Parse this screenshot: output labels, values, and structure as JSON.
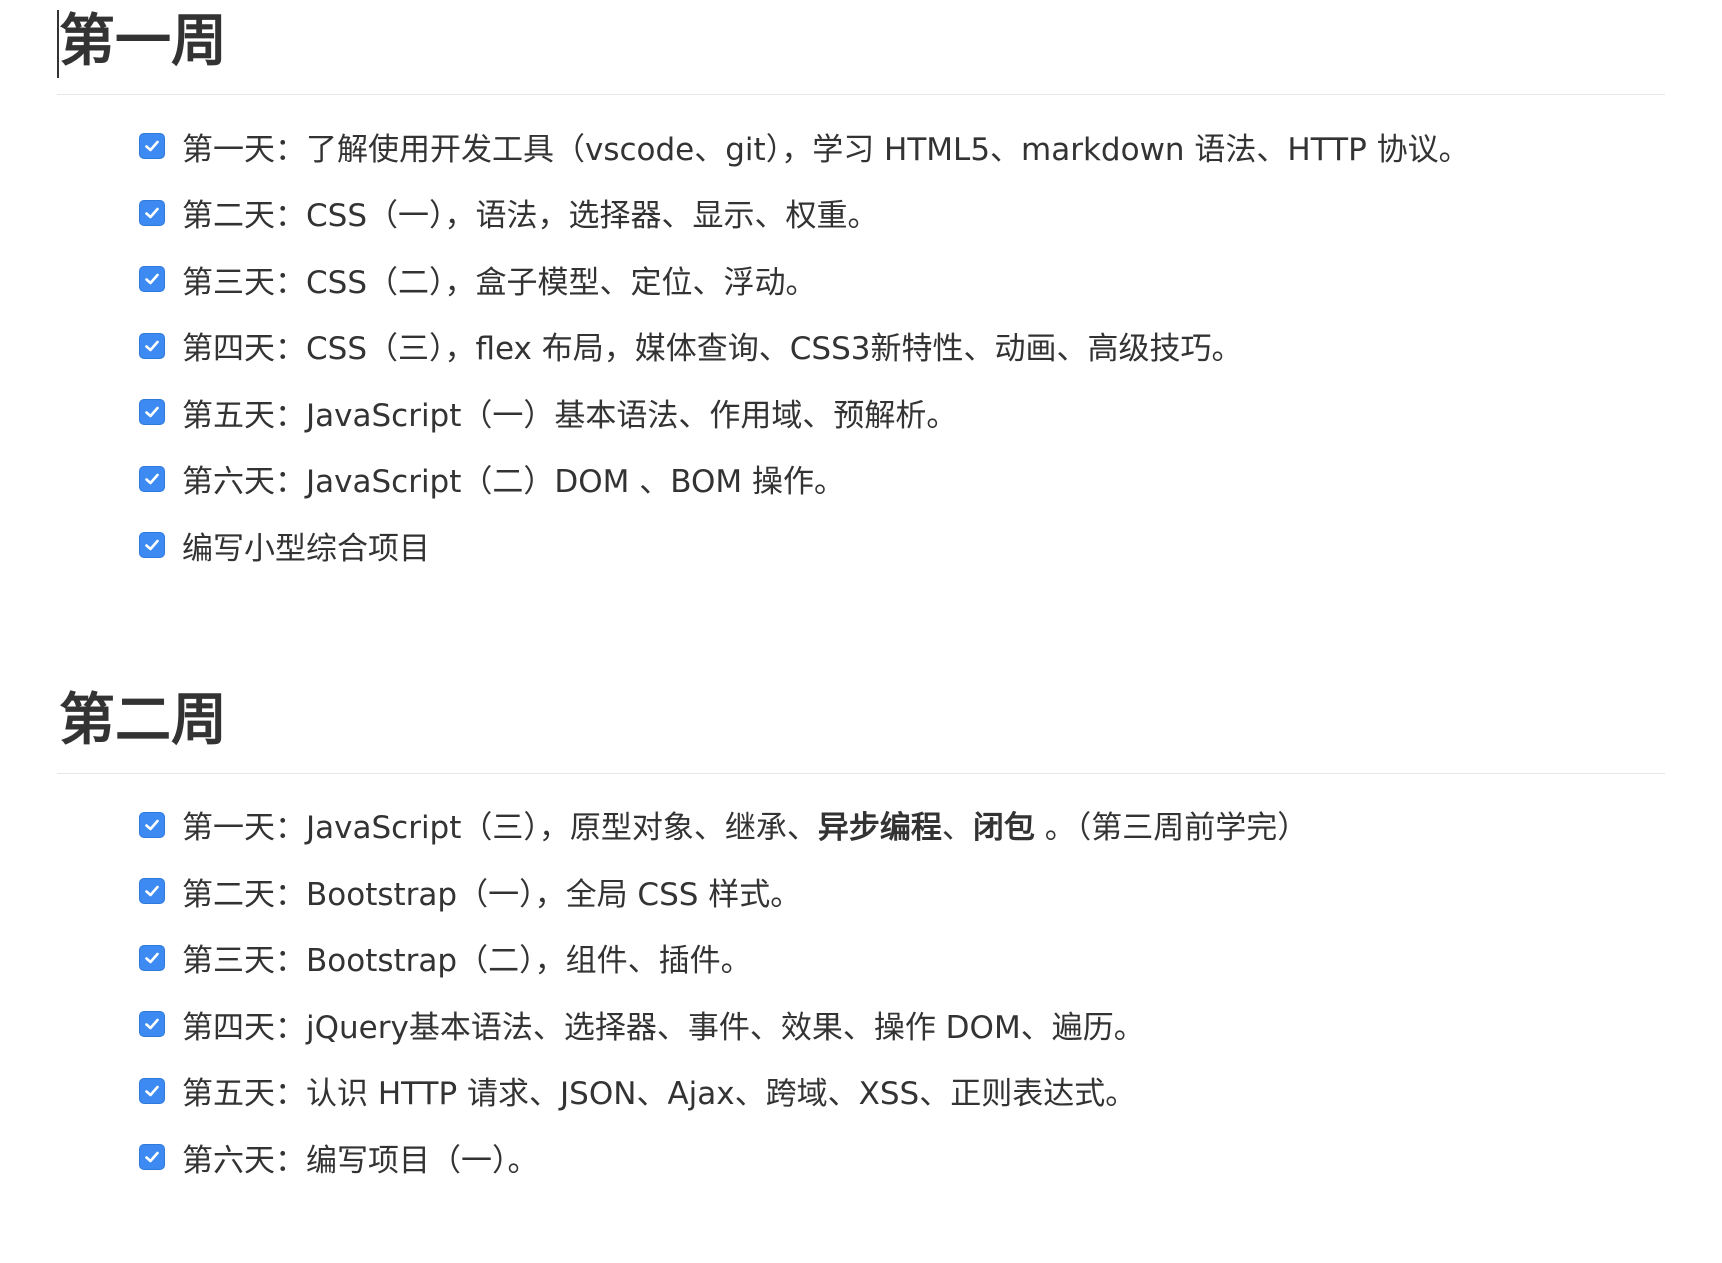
{
  "weeks": [
    {
      "title": "第一周",
      "tasks": [
        {
          "checked": true,
          "text": "第一天：了解使用开发工具（vscode、git），学习 HTML5、markdown 语法、HTTP 协议。"
        },
        {
          "checked": true,
          "text": "第二天：CSS（一），语法，选择器、显示、权重。"
        },
        {
          "checked": true,
          "text": "第三天：CSS（二），盒子模型、定位、浮动。"
        },
        {
          "checked": true,
          "text": "第四天：CSS（三），flex 布局，媒体查询、CSS3新特性、动画、高级技巧。"
        },
        {
          "checked": true,
          "text": "第五天：JavaScript（一）基本语法、作用域、预解析。"
        },
        {
          "checked": true,
          "text": "第六天：JavaScript（二）DOM 、BOM 操作。"
        },
        {
          "checked": true,
          "text": "编写小型综合项目"
        }
      ]
    },
    {
      "title": "第二周",
      "tasks": [
        {
          "checked": true,
          "prefix": "第一天：JavaScript（三），原型对象、继承、",
          "bold_1": "异步编程",
          "middle": "、",
          "bold_2": "闭包",
          "suffix": " 。（第三周前学完）"
        },
        {
          "checked": true,
          "text": "第二天：Bootstrap（一），全局 CSS 样式。"
        },
        {
          "checked": true,
          "text": "第三天：Bootstrap（二），组件、插件。"
        },
        {
          "checked": true,
          "text": "第四天：jQuery基本语法、选择器、事件、效果、操作 DOM、遍历。"
        },
        {
          "checked": true,
          "text": "第五天：认识 HTTP 请求、JSON、Ajax、跨域、XSS、正则表达式。"
        },
        {
          "checked": true,
          "text": "第六天：编写项目（一）。"
        }
      ]
    }
  ],
  "colors": {
    "checkbox_fill": "#3d8bf2",
    "text": "#333333",
    "rule": "#e6e6e6"
  }
}
